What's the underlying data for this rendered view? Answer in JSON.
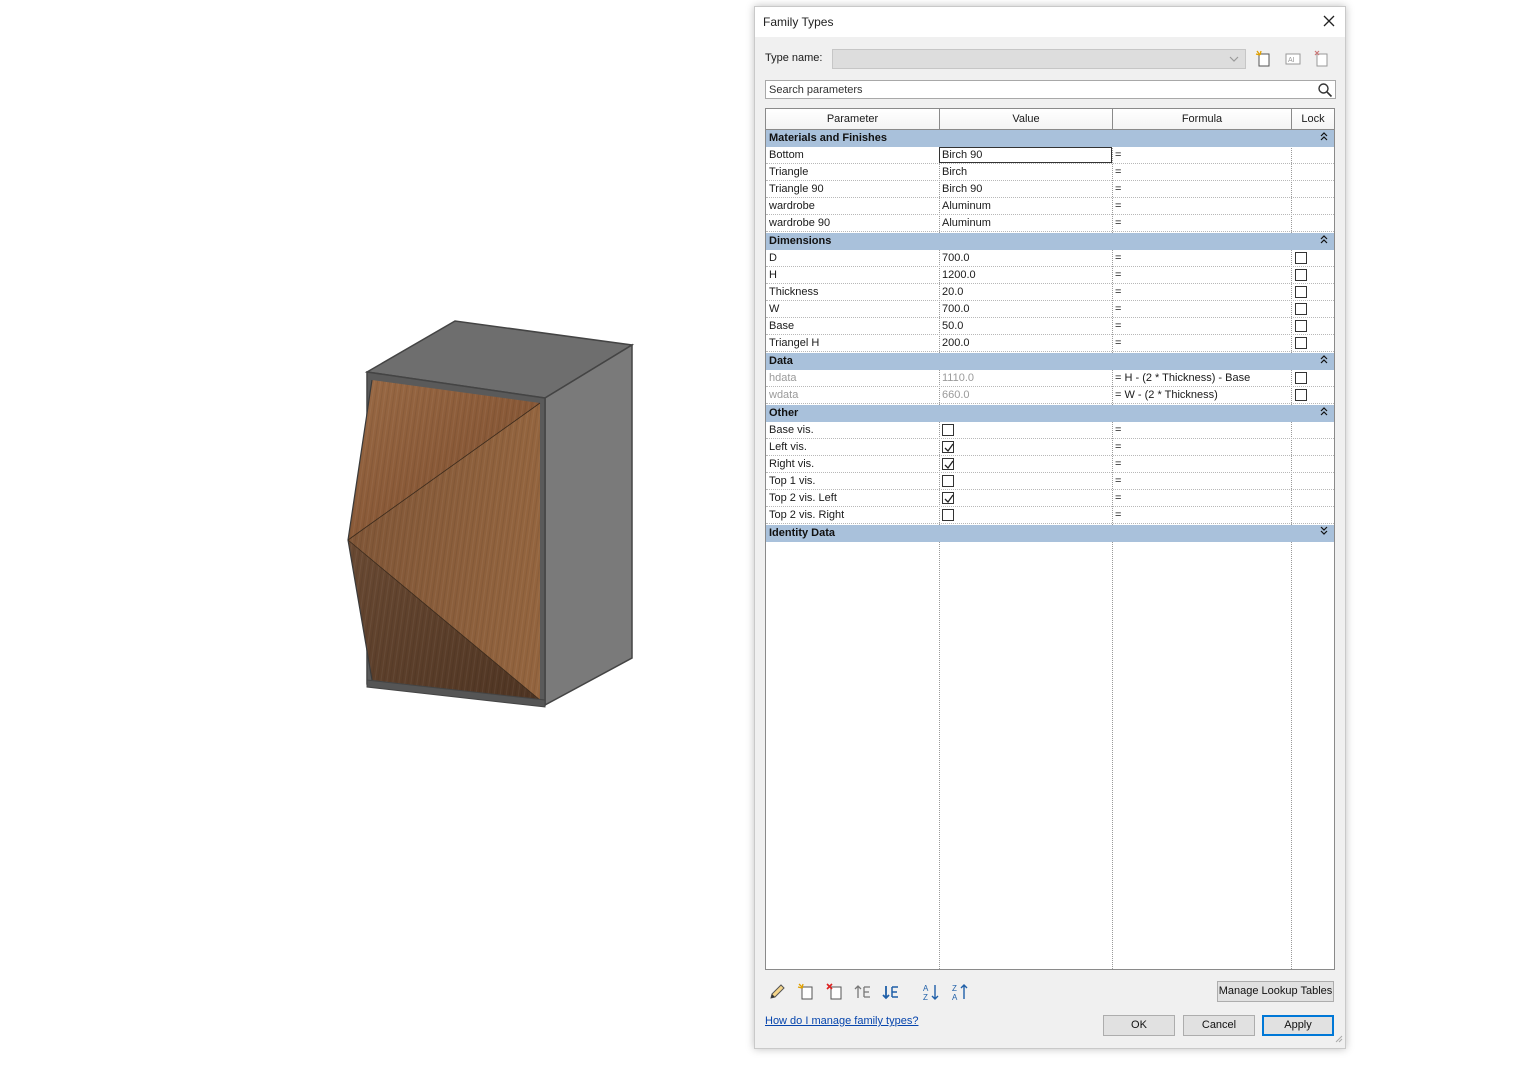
{
  "dialog": {
    "title": "Family Types",
    "type_name_label": "Type name:",
    "type_name_value": "",
    "search_placeholder": "Search parameters",
    "columns": {
      "parameter": "Parameter",
      "value": "Value",
      "formula": "Formula",
      "lock": "Lock"
    },
    "groups": [
      {
        "name": "Materials and Finishes",
        "rows": [
          {
            "parameter": "Bottom",
            "value": "Birch 90",
            "formula": "=",
            "lock": null
          },
          {
            "parameter": "Triangle",
            "value": "Birch",
            "formula": "=",
            "lock": null
          },
          {
            "parameter": "Triangle 90",
            "value": "Birch 90",
            "formula": "=",
            "lock": null
          },
          {
            "parameter": "wardrobe",
            "value": "Aluminum",
            "formula": "=",
            "lock": null
          },
          {
            "parameter": "wardrobe 90",
            "value": "Aluminum",
            "formula": "=",
            "lock": null
          }
        ]
      },
      {
        "name": "Dimensions",
        "rows": [
          {
            "parameter": "D",
            "value": "700.0",
            "formula": "=",
            "lock": false
          },
          {
            "parameter": "H",
            "value": "1200.0",
            "formula": "=",
            "lock": false
          },
          {
            "parameter": "Thickness",
            "value": "20.0",
            "formula": "=",
            "lock": false
          },
          {
            "parameter": "W",
            "value": "700.0",
            "formula": "=",
            "lock": false
          },
          {
            "parameter": "Base",
            "value": "50.0",
            "formula": "=",
            "lock": false
          },
          {
            "parameter": "Triangel H",
            "value": "200.0",
            "formula": "=",
            "lock": false
          }
        ]
      },
      {
        "name": "Data",
        "rows": [
          {
            "parameter": "hdata",
            "value": "1110.0",
            "formula": "= H - (2 * Thickness) - Base",
            "lock": false
          },
          {
            "parameter": "wdata",
            "value": "660.0",
            "formula": "= W - (2 * Thickness)",
            "lock": false
          }
        ]
      },
      {
        "name": "Other",
        "rows": [
          {
            "parameter": "Base vis.",
            "checked": false,
            "formula": "="
          },
          {
            "parameter": "Left vis.",
            "checked": true,
            "formula": "="
          },
          {
            "parameter": "Right vis.",
            "checked": true,
            "formula": "="
          },
          {
            "parameter": "Top 1 vis.",
            "checked": false,
            "formula": "="
          },
          {
            "parameter": "Top 2 vis. Left",
            "checked": true,
            "formula": "="
          },
          {
            "parameter": "Top 2 vis. Right",
            "checked": false,
            "formula": "="
          }
        ]
      },
      {
        "name": "Identity Data",
        "collapsed": true,
        "rows": []
      }
    ],
    "footer": {
      "manage_lookup": "Manage Lookup Tables",
      "help_link": "How do I manage family types?",
      "ok": "OK",
      "cancel": "Cancel",
      "apply": "Apply"
    },
    "icons": {
      "type_name_toolbar": [
        "new-type-icon",
        "rename-type-icon",
        "delete-type-icon"
      ],
      "bottom_toolbar": [
        "edit-parameter-icon",
        "new-parameter-icon",
        "delete-parameter-icon",
        "move-up-icon",
        "move-down-icon",
        "sort-ascending-icon",
        "sort-descending-icon"
      ]
    },
    "colors": {
      "group_header": "#a9c1db",
      "link": "#0645ad",
      "accent": "#0078d7"
    }
  }
}
